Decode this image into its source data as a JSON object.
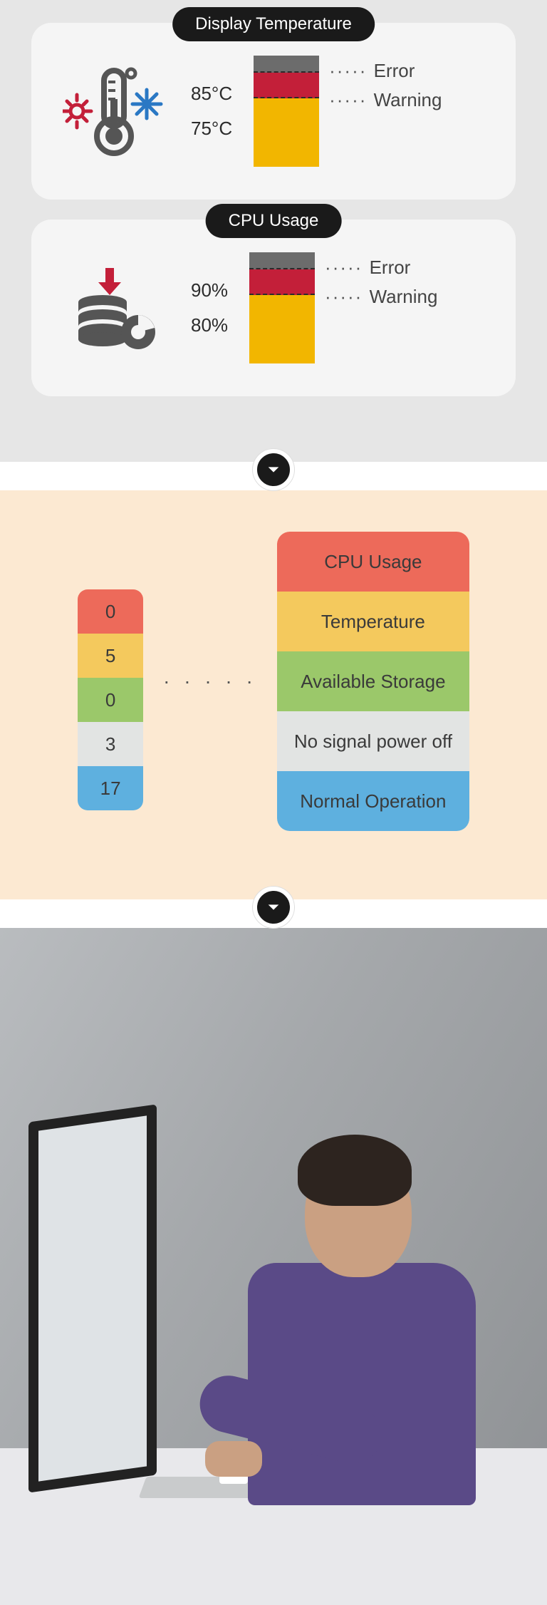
{
  "cards": {
    "temp": {
      "title": "Display Temperature",
      "r_error": "85°C",
      "r_warn": "75°C",
      "lbl_error": "Error",
      "lbl_warn": "Warning"
    },
    "cpu": {
      "title": "CPU Usage",
      "r_error": "90%",
      "r_warn": "80%",
      "lbl_error": "Error",
      "lbl_warn": "Warning"
    }
  },
  "legend": {
    "nums": [
      "0",
      "5",
      "0",
      "3",
      "17"
    ],
    "labels": [
      "CPU Usage",
      "Temperature",
      "Available Storage",
      "No signal power off",
      "Normal Operation"
    ],
    "dots": "·   ·   ·   ·   ·"
  },
  "chart_data": [
    {
      "type": "table",
      "title": "Display Temperature thresholds",
      "rows": [
        {
          "threshold": "85°C",
          "state": "Error"
        },
        {
          "threshold": "75°C",
          "state": "Warning"
        }
      ]
    },
    {
      "type": "table",
      "title": "CPU Usage thresholds",
      "rows": [
        {
          "threshold": "90%",
          "state": "Error"
        },
        {
          "threshold": "80%",
          "state": "Warning"
        }
      ]
    },
    {
      "type": "table",
      "title": "Status category counts",
      "rows": [
        {
          "category": "CPU Usage",
          "count": 0,
          "color": "#ed6a5a"
        },
        {
          "category": "Temperature",
          "count": 5,
          "color": "#f4c95d"
        },
        {
          "category": "Available Storage",
          "count": 0,
          "color": "#9bc86a"
        },
        {
          "category": "No signal power off",
          "count": 3,
          "color": "#e2e4e3"
        },
        {
          "category": "Normal Operation",
          "count": 17,
          "color": "#5eb0df"
        }
      ]
    }
  ]
}
